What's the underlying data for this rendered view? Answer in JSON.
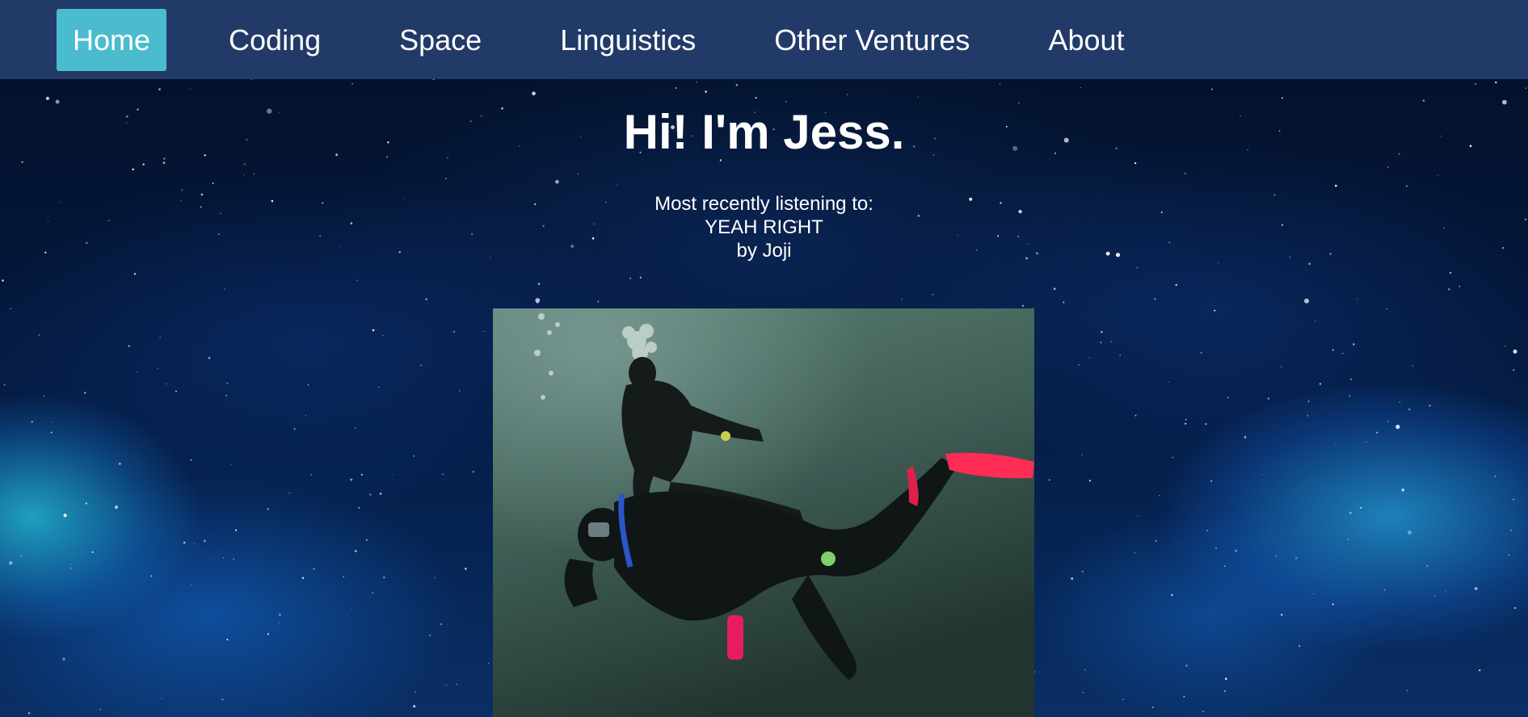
{
  "nav": {
    "items": [
      {
        "label": "Home",
        "active": true
      },
      {
        "label": "Coding",
        "active": false
      },
      {
        "label": "Space",
        "active": false
      },
      {
        "label": "Linguistics",
        "active": false
      },
      {
        "label": "Other Ventures",
        "active": false
      },
      {
        "label": "About",
        "active": false
      }
    ]
  },
  "hero": {
    "title": "Hi! I'm Jess."
  },
  "now_playing": {
    "heading": "Most recently listening to:",
    "song": "YEAH RIGHT",
    "artist_line": "by Joji"
  },
  "colors": {
    "nav_bg": "#223a68",
    "nav_active_bg": "#4bbccd",
    "text": "#ffffff"
  },
  "images": {
    "photo": "scuba-divers-underwater-photo"
  }
}
